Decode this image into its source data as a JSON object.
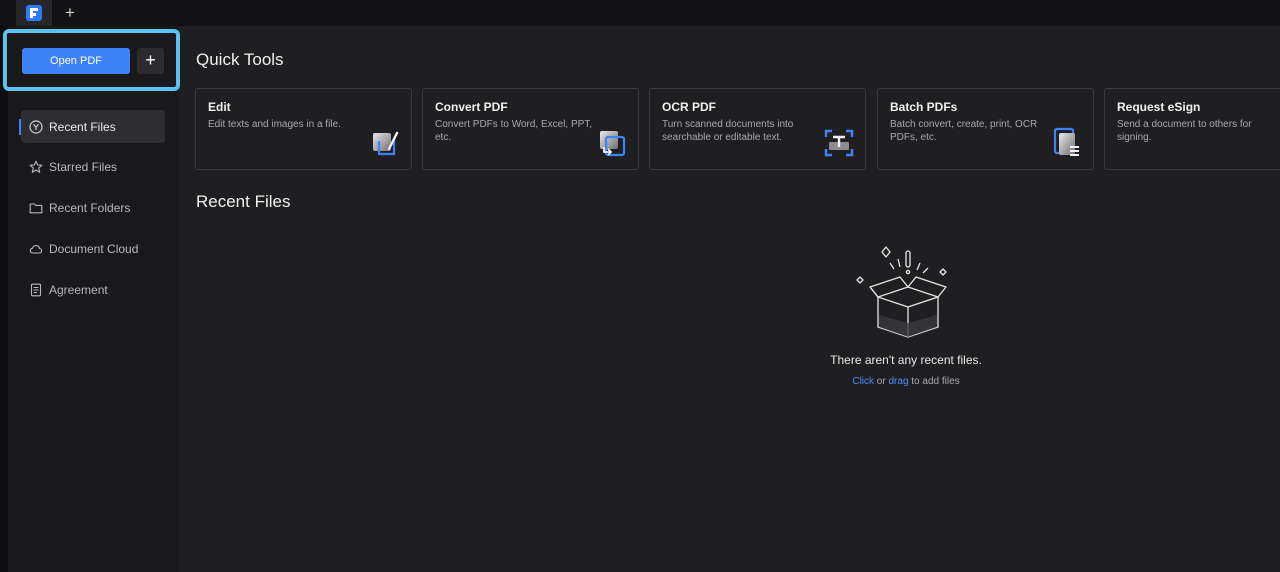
{
  "topbar": {
    "new_tab_label": "+"
  },
  "sidebar": {
    "open_pdf_label": "Open PDF",
    "add_label": "+",
    "items": [
      {
        "label": "Recent Files",
        "icon": "clock-icon",
        "active": true
      },
      {
        "label": "Starred Files",
        "icon": "star-icon",
        "active": false
      },
      {
        "label": "Recent Folders",
        "icon": "folder-icon",
        "active": false
      },
      {
        "label": "Document Cloud",
        "icon": "cloud-icon",
        "active": false
      },
      {
        "label": "Agreement",
        "icon": "document-icon",
        "active": false
      }
    ]
  },
  "main": {
    "quick_tools_title": "Quick Tools",
    "tools": [
      {
        "title": "Edit",
        "desc": "Edit texts and images in a file.",
        "icon": "edit-icon"
      },
      {
        "title": "Convert PDF",
        "desc": "Convert PDFs to Word, Excel, PPT, etc.",
        "icon": "convert-icon"
      },
      {
        "title": "OCR PDF",
        "desc": "Turn scanned documents into searchable or editable text.",
        "icon": "ocr-icon"
      },
      {
        "title": "Batch PDFs",
        "desc": "Batch convert, create, print, OCR PDFs, etc.",
        "icon": "batch-icon"
      },
      {
        "title": "Request eSign",
        "desc": "Send a document to others for signing.",
        "icon": "esign-icon"
      }
    ],
    "recent_files_title": "Recent Files",
    "empty": {
      "message": "There aren't any recent files.",
      "click": "Click",
      "or": "or",
      "drag": "drag",
      "suffix": "to add files"
    }
  },
  "colors": {
    "accent": "#3d82f6",
    "highlight": "#5bc1f0",
    "background": "#1f1f22"
  }
}
